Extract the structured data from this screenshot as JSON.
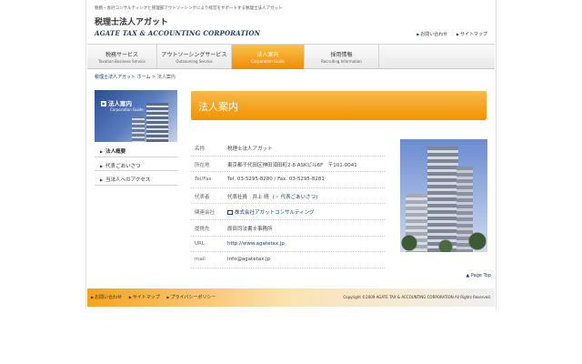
{
  "header": {
    "tagline": "税務・会計コンサルティングと管理部アウトソーシングにより経営をサポートする税理士法人アガット",
    "logo_jp": "税理士法人アガット",
    "logo_en": "AGATE TAX & ACCOUNTING CORPORATION",
    "links": [
      {
        "label": "お問い合わせ",
        "icon": "arrow-icon"
      },
      {
        "label": "サイトマップ",
        "icon": "arrow-icon"
      }
    ]
  },
  "nav": {
    "items": [
      {
        "jp": "税務サービス",
        "en": "Taxation Business Service"
      },
      {
        "jp": "アウトソーシングサービス",
        "en": "Outsourcing Service"
      },
      {
        "jp": "法人案内",
        "en": "Corporation Guide",
        "active": true
      },
      {
        "jp": "採用情報",
        "en": "Recruiting Information"
      }
    ]
  },
  "breadcrumb": {
    "home": "税理士法人アガット ホーム",
    "separator": " > ",
    "current": "法人案内"
  },
  "sidebar": {
    "banner_title": "法人案内",
    "banner_sub": "Corporation Guide",
    "items": [
      {
        "label": "法人概要"
      },
      {
        "label": "代表ごあいさつ"
      },
      {
        "label": "当法人へのアクセス"
      }
    ]
  },
  "page_title": "法人案内",
  "info": {
    "rows": [
      {
        "key": "名称",
        "value": "税理士法人アガット"
      },
      {
        "key": "所在地",
        "value": "東京都千代田区神田須田町2-8 ASKビル6F　〒101-0041"
      },
      {
        "key": "Tel/Fax",
        "value": "Tel. 03-5295-8280 / Fax. 03-5295-8281"
      },
      {
        "key": "代表者",
        "value": "代表社員　井上 晴",
        "extra": "(☞ 代表ごあいさつ)"
      },
      {
        "key": "関連会社",
        "value": "株式会社アガットコンサルティング"
      },
      {
        "key": "提携先",
        "value": "原田司法書士事務所"
      },
      {
        "key": "URL",
        "value": "http://www.agatetax.jp"
      },
      {
        "key": "mail",
        "value": "info@agatetax.jp"
      }
    ]
  },
  "page_top": "▲ Page Top",
  "footer": {
    "links": [
      {
        "label": "お問い合わせ"
      },
      {
        "label": "サイトマップ"
      },
      {
        "label": "プライバシーポリシー"
      }
    ],
    "copyright": "Copyright ©2009 AGATE TAX & ACCOUNTING CORPORATION All Rights Reserved."
  },
  "colors": {
    "accent": "#f29300",
    "brand": "#1f3a7a"
  }
}
